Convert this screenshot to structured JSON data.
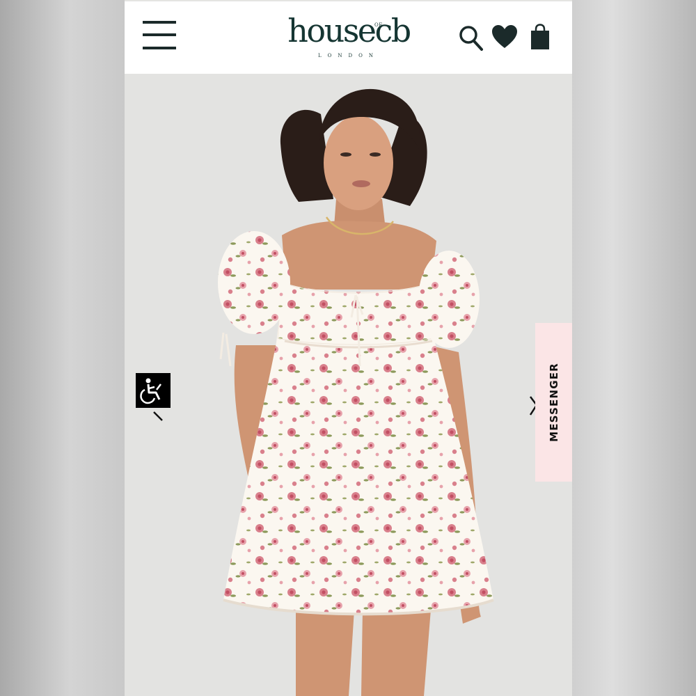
{
  "header": {
    "logo_main": "house",
    "logo_small": "OF",
    "logo_tail": "cb",
    "logo_sub": "LONDON",
    "icons": [
      "menu-icon",
      "search-icon",
      "heart-icon",
      "bag-icon"
    ]
  },
  "hero": {
    "image": "model-in-floral-puff-sleeve-mini-dress",
    "dress_colors": [
      "#fbf7f0",
      "#d9808c",
      "#c24f63",
      "#8d9a5b"
    ]
  },
  "accessibility": {
    "icon": "wheelchair-icon"
  },
  "messenger": {
    "label": "MESSENGER"
  },
  "colors": {
    "brand": "#153532",
    "messenger_bg": "#fbe5e6",
    "header_bg": "#ffffff"
  }
}
